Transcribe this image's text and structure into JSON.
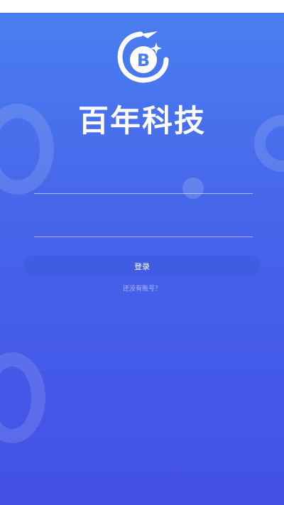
{
  "brand": {
    "name": "百年科技",
    "logo_letter": "B"
  },
  "form": {
    "username": {
      "value": "",
      "placeholder": ""
    },
    "password": {
      "value": "",
      "placeholder": ""
    }
  },
  "actions": {
    "login_label": "登录",
    "register_label": "还没有账号？"
  },
  "colors": {
    "gradient_top": "#4a7ef0",
    "gradient_bottom": "#4350e6",
    "text": "#ffffff"
  }
}
